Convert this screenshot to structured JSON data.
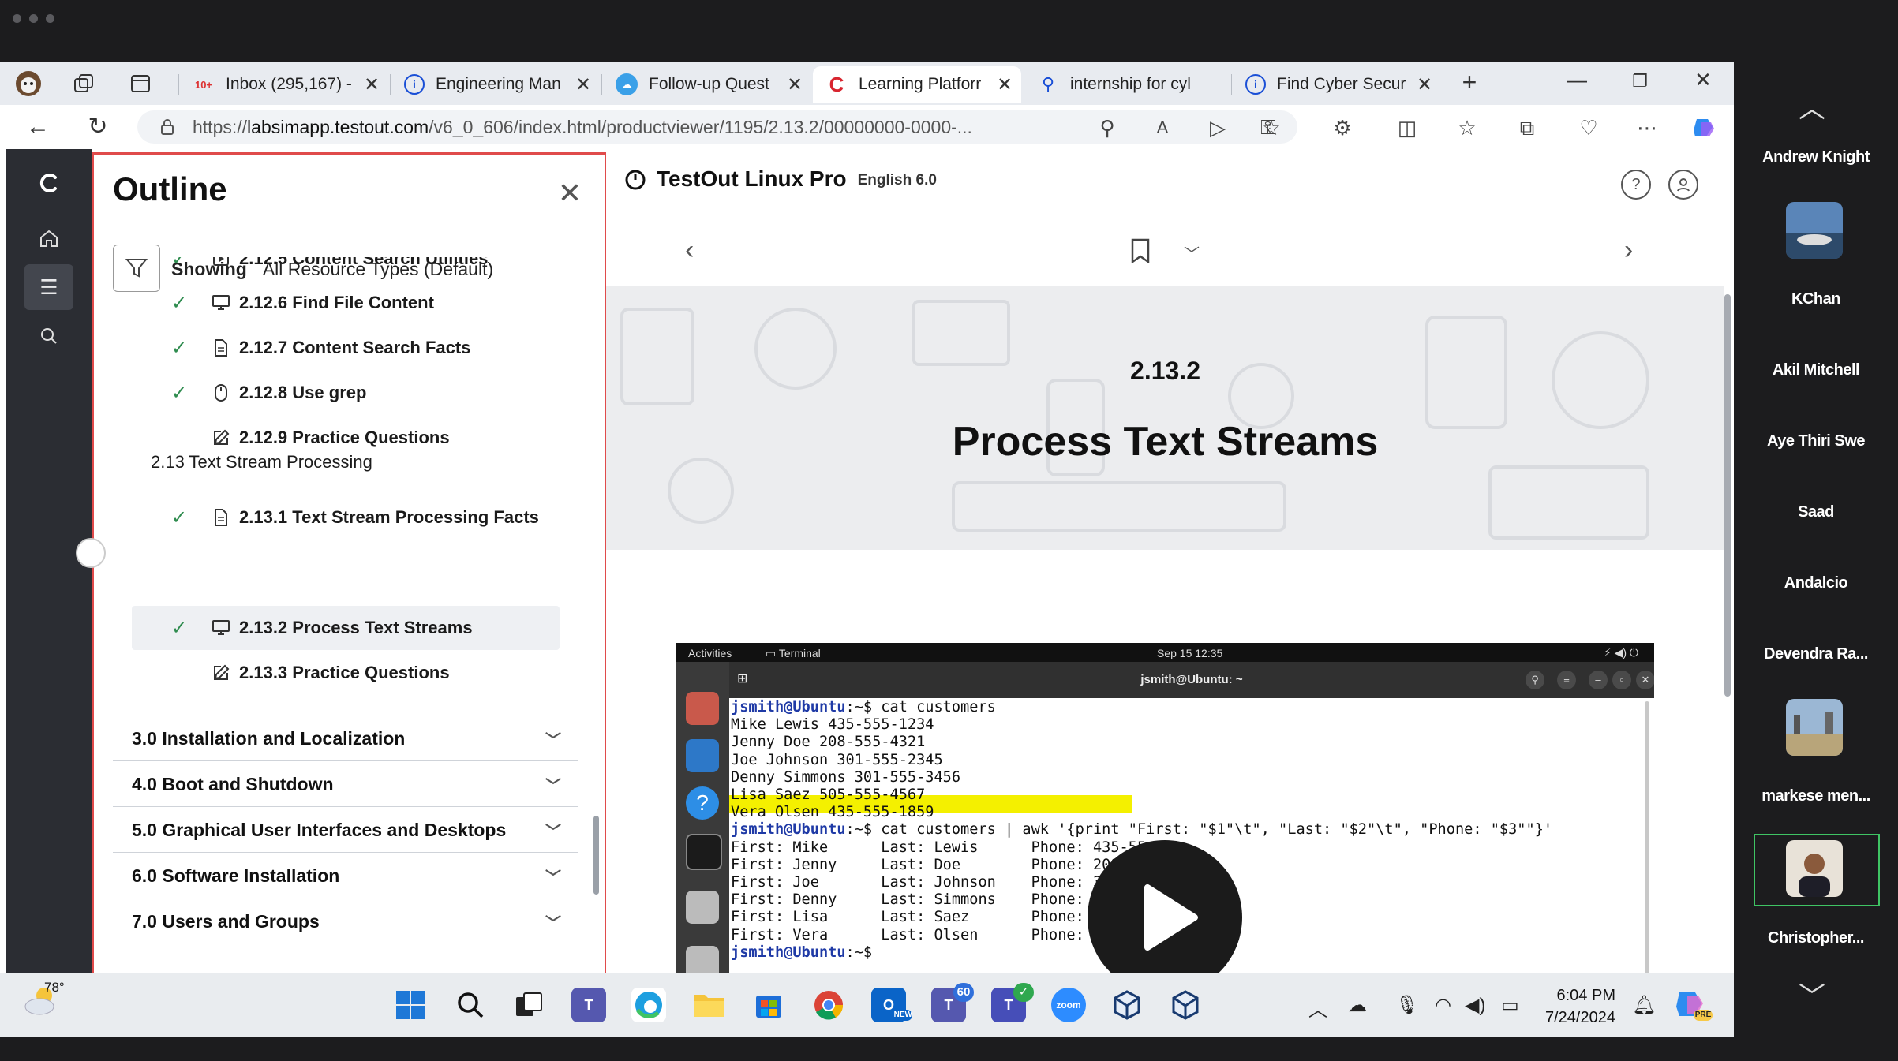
{
  "browser": {
    "tabs": [
      {
        "title": "Inbox (295,167) -",
        "favicon": "gmail-icon"
      },
      {
        "title": "Engineering Man",
        "favicon": "info-icon"
      },
      {
        "title": "Follow-up Quest",
        "favicon": "cloud-icon"
      },
      {
        "title": "Learning Platforr",
        "favicon": "testout-icon"
      },
      {
        "title": "internship for cyl",
        "favicon": "search-icon"
      },
      {
        "title": "Find Cyber Secur",
        "favicon": "info-icon"
      }
    ],
    "gmail_badge": "10+",
    "url_prefix": "https://",
    "url_domain": "labsimapp.testout.com",
    "url_path": "/v6_0_606/index.html/productviewer/1195/2.13.2/00000000-0000-..."
  },
  "outline": {
    "title": "Outline",
    "filter_label": "Showing",
    "filter_value": "All Resource Types (Default)",
    "items": [
      {
        "label": "2.12.5 Content Search Utilities",
        "done": true,
        "icon": "video-icon"
      },
      {
        "label": "2.12.6 Find File Content",
        "done": true,
        "icon": "monitor-icon"
      },
      {
        "label": "2.12.7 Content Search Facts",
        "done": true,
        "icon": "document-icon"
      },
      {
        "label": "2.12.8 Use grep",
        "done": true,
        "icon": "mouse-icon"
      },
      {
        "label": "2.12.9 Practice Questions",
        "done": false,
        "icon": "edit-icon"
      },
      {
        "label": "2.13.1 Text Stream Processing Facts",
        "done": true,
        "icon": "document-icon"
      },
      {
        "label": "2.13.2 Process Text Streams",
        "done": true,
        "icon": "monitor-icon"
      },
      {
        "label": "2.13.3 Practice Questions",
        "done": false,
        "icon": "edit-icon"
      }
    ],
    "section": "2.13 Text Stream Processing",
    "chapters": [
      "3.0 Installation and Localization",
      "4.0 Boot and Shutdown",
      "5.0 Graphical User Interfaces and Desktops",
      "6.0 Software Installation",
      "7.0 Users and Groups"
    ]
  },
  "content": {
    "course": "TestOut Linux Pro",
    "language": "English 6.0",
    "lesson_number": "2.13.2",
    "lesson_title": "Process Text Streams"
  },
  "video": {
    "topbar_activities": "Activities",
    "topbar_app": "Terminal",
    "topbar_time": "Sep 15  12:35",
    "window_title": "jsmith@Ubuntu: ~",
    "terminal_lines": [
      {
        "prompt": "jsmith@Ubuntu",
        "text": ":~$ cat customers"
      },
      {
        "text": "Mike Lewis 435-555-1234"
      },
      {
        "text": "Jenny Doe 208-555-4321"
      },
      {
        "text": "Joe Johnson 301-555-2345"
      },
      {
        "text": "Denny Simmons 301-555-3456"
      },
      {
        "text": "Lisa Saez 505-555-4567"
      },
      {
        "text": "Vera Olsen 435-555-1859"
      },
      {
        "prompt": "jsmith@Ubuntu",
        "text": ":~$ cat customers | awk '{print \"First: \"$1\"\\t\", \"Last: \"$2\"\\t\", \"Phone: \"$3\"\"}'"
      },
      {
        "text": "First: Mike      Last: Lewis      Phone: 435-55"
      },
      {
        "text": "First: Jenny     Last: Doe        Phone: 208-"
      },
      {
        "text": "First: Joe       Last: Johnson    Phone: 30"
      },
      {
        "text": "First: Denny     Last: Simmons    Phone: 30"
      },
      {
        "text": "First: Lisa      Last: Saez       Phone: 50"
      },
      {
        "text": "First: Vera      Last: Olsen      Phone: 43"
      },
      {
        "prompt": "jsmith@Ubuntu",
        "text": ":~$"
      }
    ]
  },
  "taskbar": {
    "weather_temp": "78°",
    "teams_badge": "60",
    "time": "6:04 PM",
    "date": "7/24/2024",
    "zoom_label": "zoom",
    "new_label": "NEW",
    "pre_label": "PRE"
  },
  "participants": [
    "Andrew Knight",
    "KChan",
    "Akil Mitchell",
    "Aye Thiri Swe",
    "Saad",
    "Andalcio",
    "Devendra Ra...",
    "markese men...",
    "Christopher..."
  ]
}
